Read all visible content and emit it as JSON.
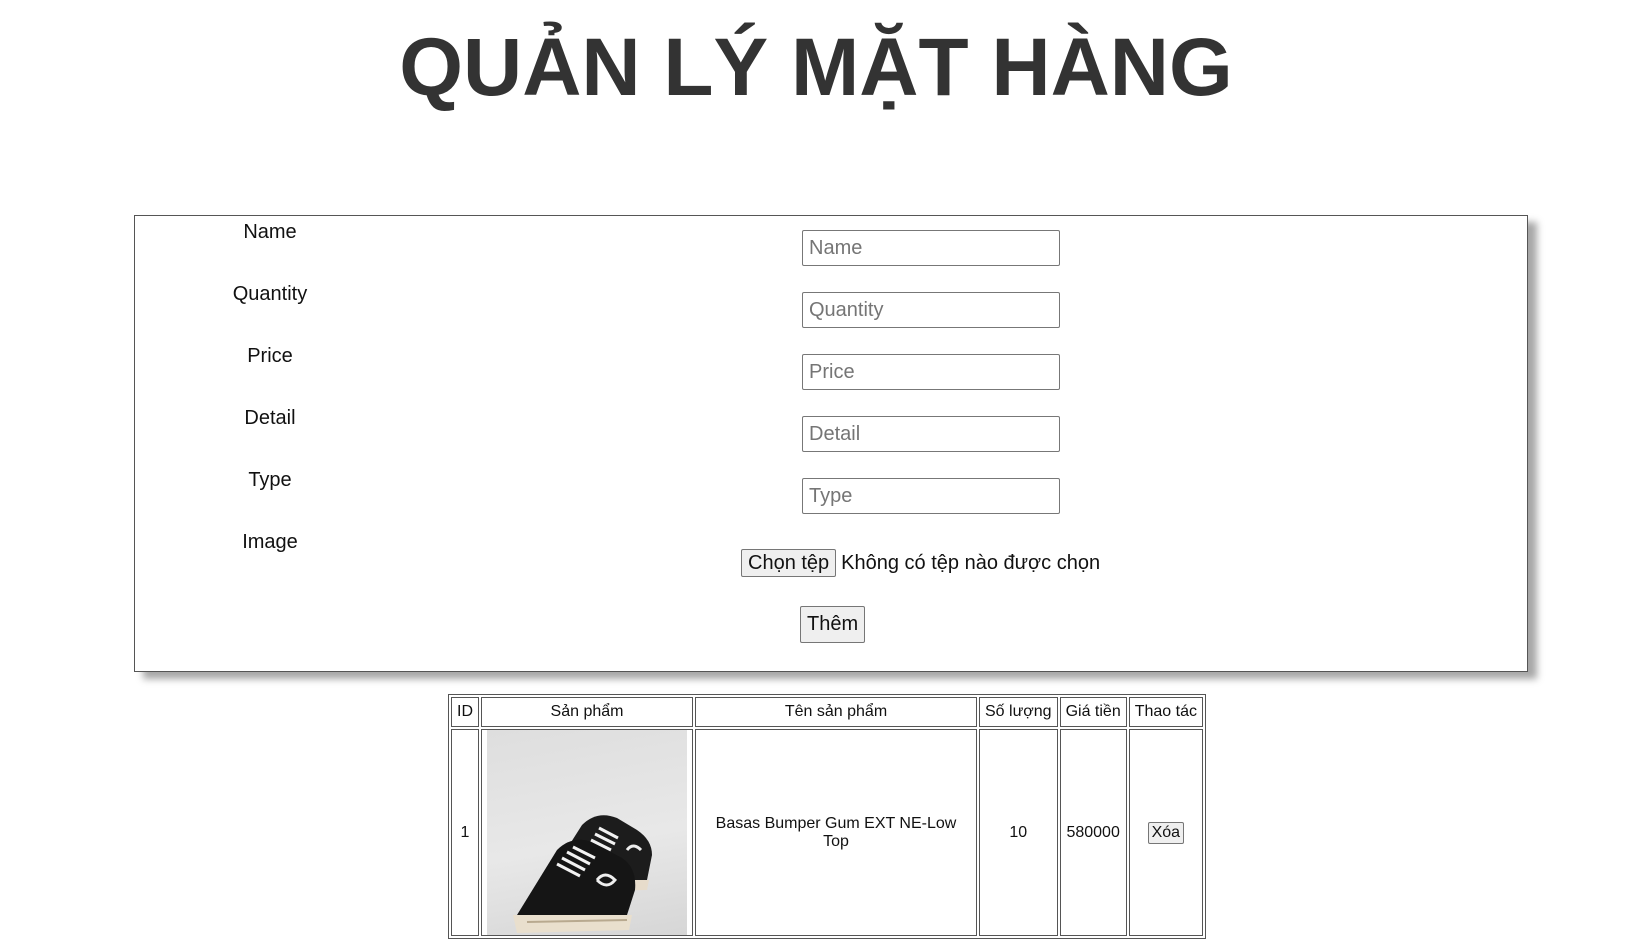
{
  "page": {
    "title": "QUẢN LÝ MẶT HÀNG"
  },
  "form": {
    "fields": [
      {
        "label": "Name",
        "placeholder": "Name",
        "value": ""
      },
      {
        "label": "Quantity",
        "placeholder": "Quantity",
        "value": ""
      },
      {
        "label": "Price",
        "placeholder": "Price",
        "value": ""
      },
      {
        "label": "Detail",
        "placeholder": "Detail",
        "value": ""
      },
      {
        "label": "Type",
        "placeholder": "Type",
        "value": ""
      }
    ],
    "image": {
      "label": "Image",
      "button_label": "Chọn tệp",
      "status": "Không có tệp nào được chọn"
    },
    "submit_label": "Thêm"
  },
  "table": {
    "headers": [
      "ID",
      "Sản phẩm",
      "Tên sản phẩm",
      "Số lượng",
      "Giá tiền",
      "Thao tác"
    ],
    "rows": [
      {
        "id": "1",
        "image_icon": "sneaker-image",
        "name": "Basas Bumper Gum EXT NE-Low Top",
        "quantity": "10",
        "price": "580000",
        "action_label": "Xóa"
      }
    ]
  }
}
